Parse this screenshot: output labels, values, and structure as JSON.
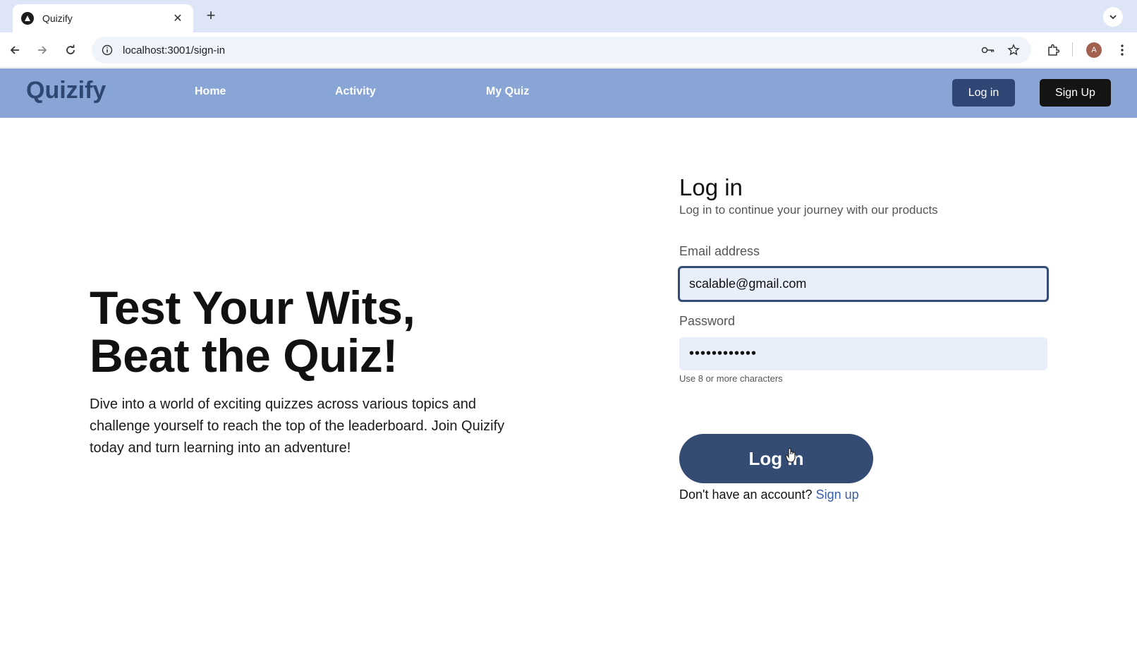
{
  "browser": {
    "tab_title": "Quizify",
    "tab_close": "✕",
    "new_tab": "+",
    "url": "localhost:3001/sign-in",
    "avatar_letter": "A"
  },
  "navbar": {
    "brand": "Quizify",
    "links": [
      "Home",
      "Activity",
      "My Quiz"
    ],
    "login_label": "Log in",
    "signup_label": "Sign Up",
    "bg_color": "#88a5d6"
  },
  "hero": {
    "title_line1": "Test Your Wits,",
    "title_line2": "Beat the Quiz!",
    "description": "Dive into a world of exciting quizzes across various topics and challenge yourself to reach the top of the leaderboard. Join Quizify today and turn learning into an adventure!"
  },
  "login_form": {
    "title": "Log in",
    "subtitle": "Log in to continue your journey with our products",
    "email_label": "Email address",
    "email_value": "scalable@gmail.com",
    "password_label": "Password",
    "password_value": "••••••••••••",
    "password_hint": "Use 8 or more characters",
    "submit_label": "Log in",
    "no_account_text": "Don't have an account? ",
    "signup_link": "Sign up",
    "accent_color": "#344b73"
  }
}
